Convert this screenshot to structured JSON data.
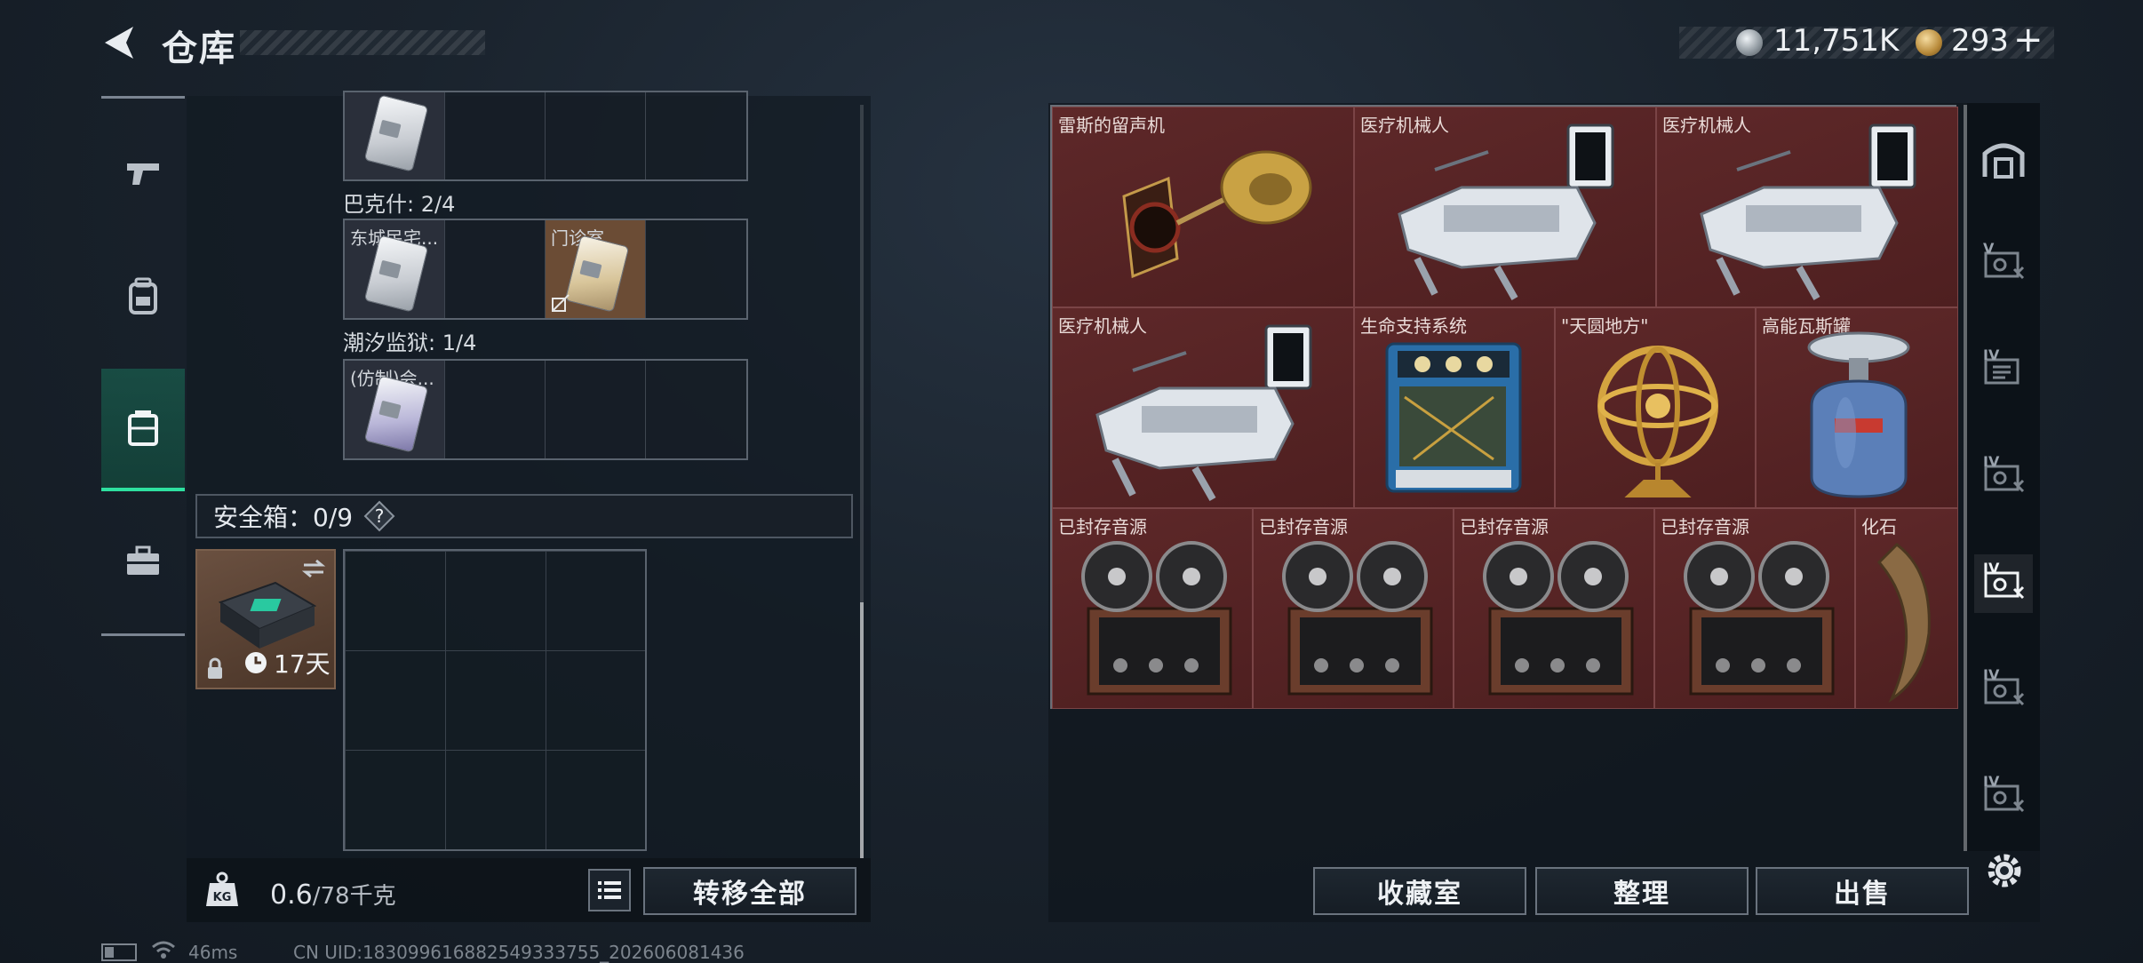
{
  "header": {
    "title": "仓库",
    "silver_amount": "11,751K",
    "gold_amount": "293"
  },
  "category_tabs": [
    {
      "icon": "pistol-icon"
    },
    {
      "icon": "backpack-icon"
    },
    {
      "icon": "container-icon",
      "active": true
    },
    {
      "icon": "briefcase-icon"
    }
  ],
  "left_panel": {
    "sections": [
      {
        "label": "",
        "cards": [
          {
            "label": "",
            "style": "white"
          }
        ]
      },
      {
        "label": "巴克什: 2/4",
        "cards": [
          {
            "label": "东城民宅...",
            "style": "white"
          },
          {
            "label": "门诊室",
            "style": "tan",
            "no_drop": true
          }
        ]
      },
      {
        "label": "潮汐监狱: 1/4",
        "cards": [
          {
            "label": "(仿制)会...",
            "style": "purple"
          }
        ]
      }
    ],
    "safe_box": {
      "title": "安全箱：0/9",
      "days": "17天"
    },
    "weight": {
      "value": "0.6",
      "capacity": "/78千克"
    },
    "transfer_label": "转移全部"
  },
  "stash_items": [
    {
      "name": "雷斯的留声机",
      "icon": "gramophone-icon"
    },
    {
      "name": "医疗机械人",
      "icon": "medical-robot-icon"
    },
    {
      "name": "医疗机械人",
      "icon": "medical-robot-icon"
    },
    {
      "name": "医疗机械人",
      "icon": "medical-robot-icon"
    },
    {
      "name": "生命支持系统",
      "icon": "life-support-icon"
    },
    {
      "name": "\"天圆地方\"",
      "icon": "armillary-sphere-icon"
    },
    {
      "name": "高能瓦斯罐",
      "icon": "gas-tank-icon"
    },
    {
      "name": "已封存音源",
      "icon": "reel-recorder-icon"
    },
    {
      "name": "已封存音源",
      "icon": "reel-recorder-icon"
    },
    {
      "name": "已封存音源",
      "icon": "reel-recorder-icon"
    },
    {
      "name": "已封存音源",
      "icon": "reel-recorder-icon"
    },
    {
      "name": "化石",
      "icon": "fossil-claw-icon"
    }
  ],
  "actions": {
    "collection": "收藏室",
    "sort": "整理",
    "sell": "出售"
  },
  "side_tabs": [
    {
      "tier": "",
      "icon": "vault-icon"
    },
    {
      "tier": "V",
      "icon": "stash-tab-icon"
    },
    {
      "tier": "IV",
      "icon": "stash-tab-icon"
    },
    {
      "tier": "IV",
      "icon": "stash-tab-icon"
    },
    {
      "tier": "IV",
      "icon": "stash-tab-icon",
      "active": true
    },
    {
      "tier": "IV",
      "icon": "stash-tab-icon"
    },
    {
      "tier": "IV",
      "icon": "stash-tab-icon"
    }
  ],
  "status": {
    "ping": "46ms",
    "uid": "CN UID:183099616882549333755_202606081436"
  }
}
